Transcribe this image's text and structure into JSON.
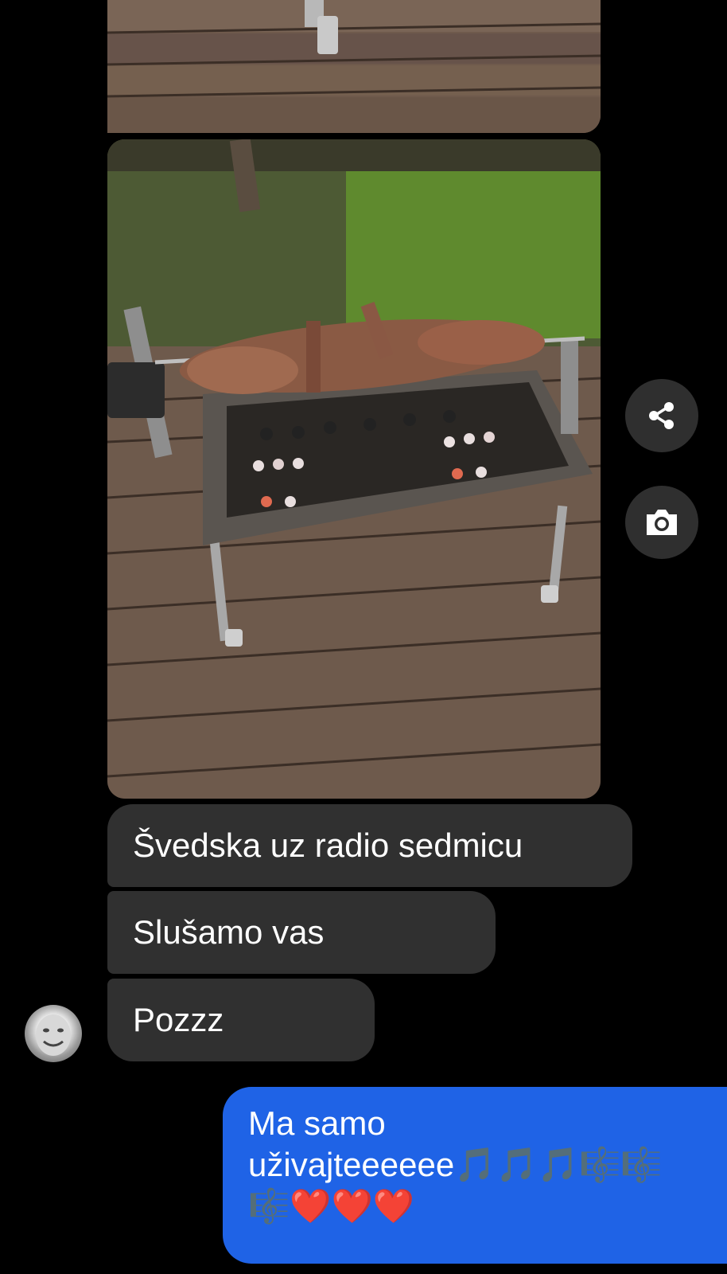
{
  "conversation": {
    "photos": [
      {
        "name": "deck-photo-top"
      },
      {
        "name": "spit-roast-grill-photo"
      }
    ],
    "photo_actions": {
      "share_icon": "share-icon",
      "camera_icon": "camera-icon"
    },
    "received_messages": [
      {
        "text": "Švedska uz radio sedmicu"
      },
      {
        "text": "Slušamo vas"
      },
      {
        "text": "Pozzz"
      }
    ],
    "sent_message": {
      "line1": "Ma samo",
      "line2": "uživajteeeeee🎵🎵🎵🎼🎼",
      "line3": "🎼❤️❤️❤️"
    }
  },
  "colors": {
    "background": "#000000",
    "received_bubble": "#303030",
    "sent_bubble": "#1f63e6",
    "action_button": "#2f2f2f"
  }
}
